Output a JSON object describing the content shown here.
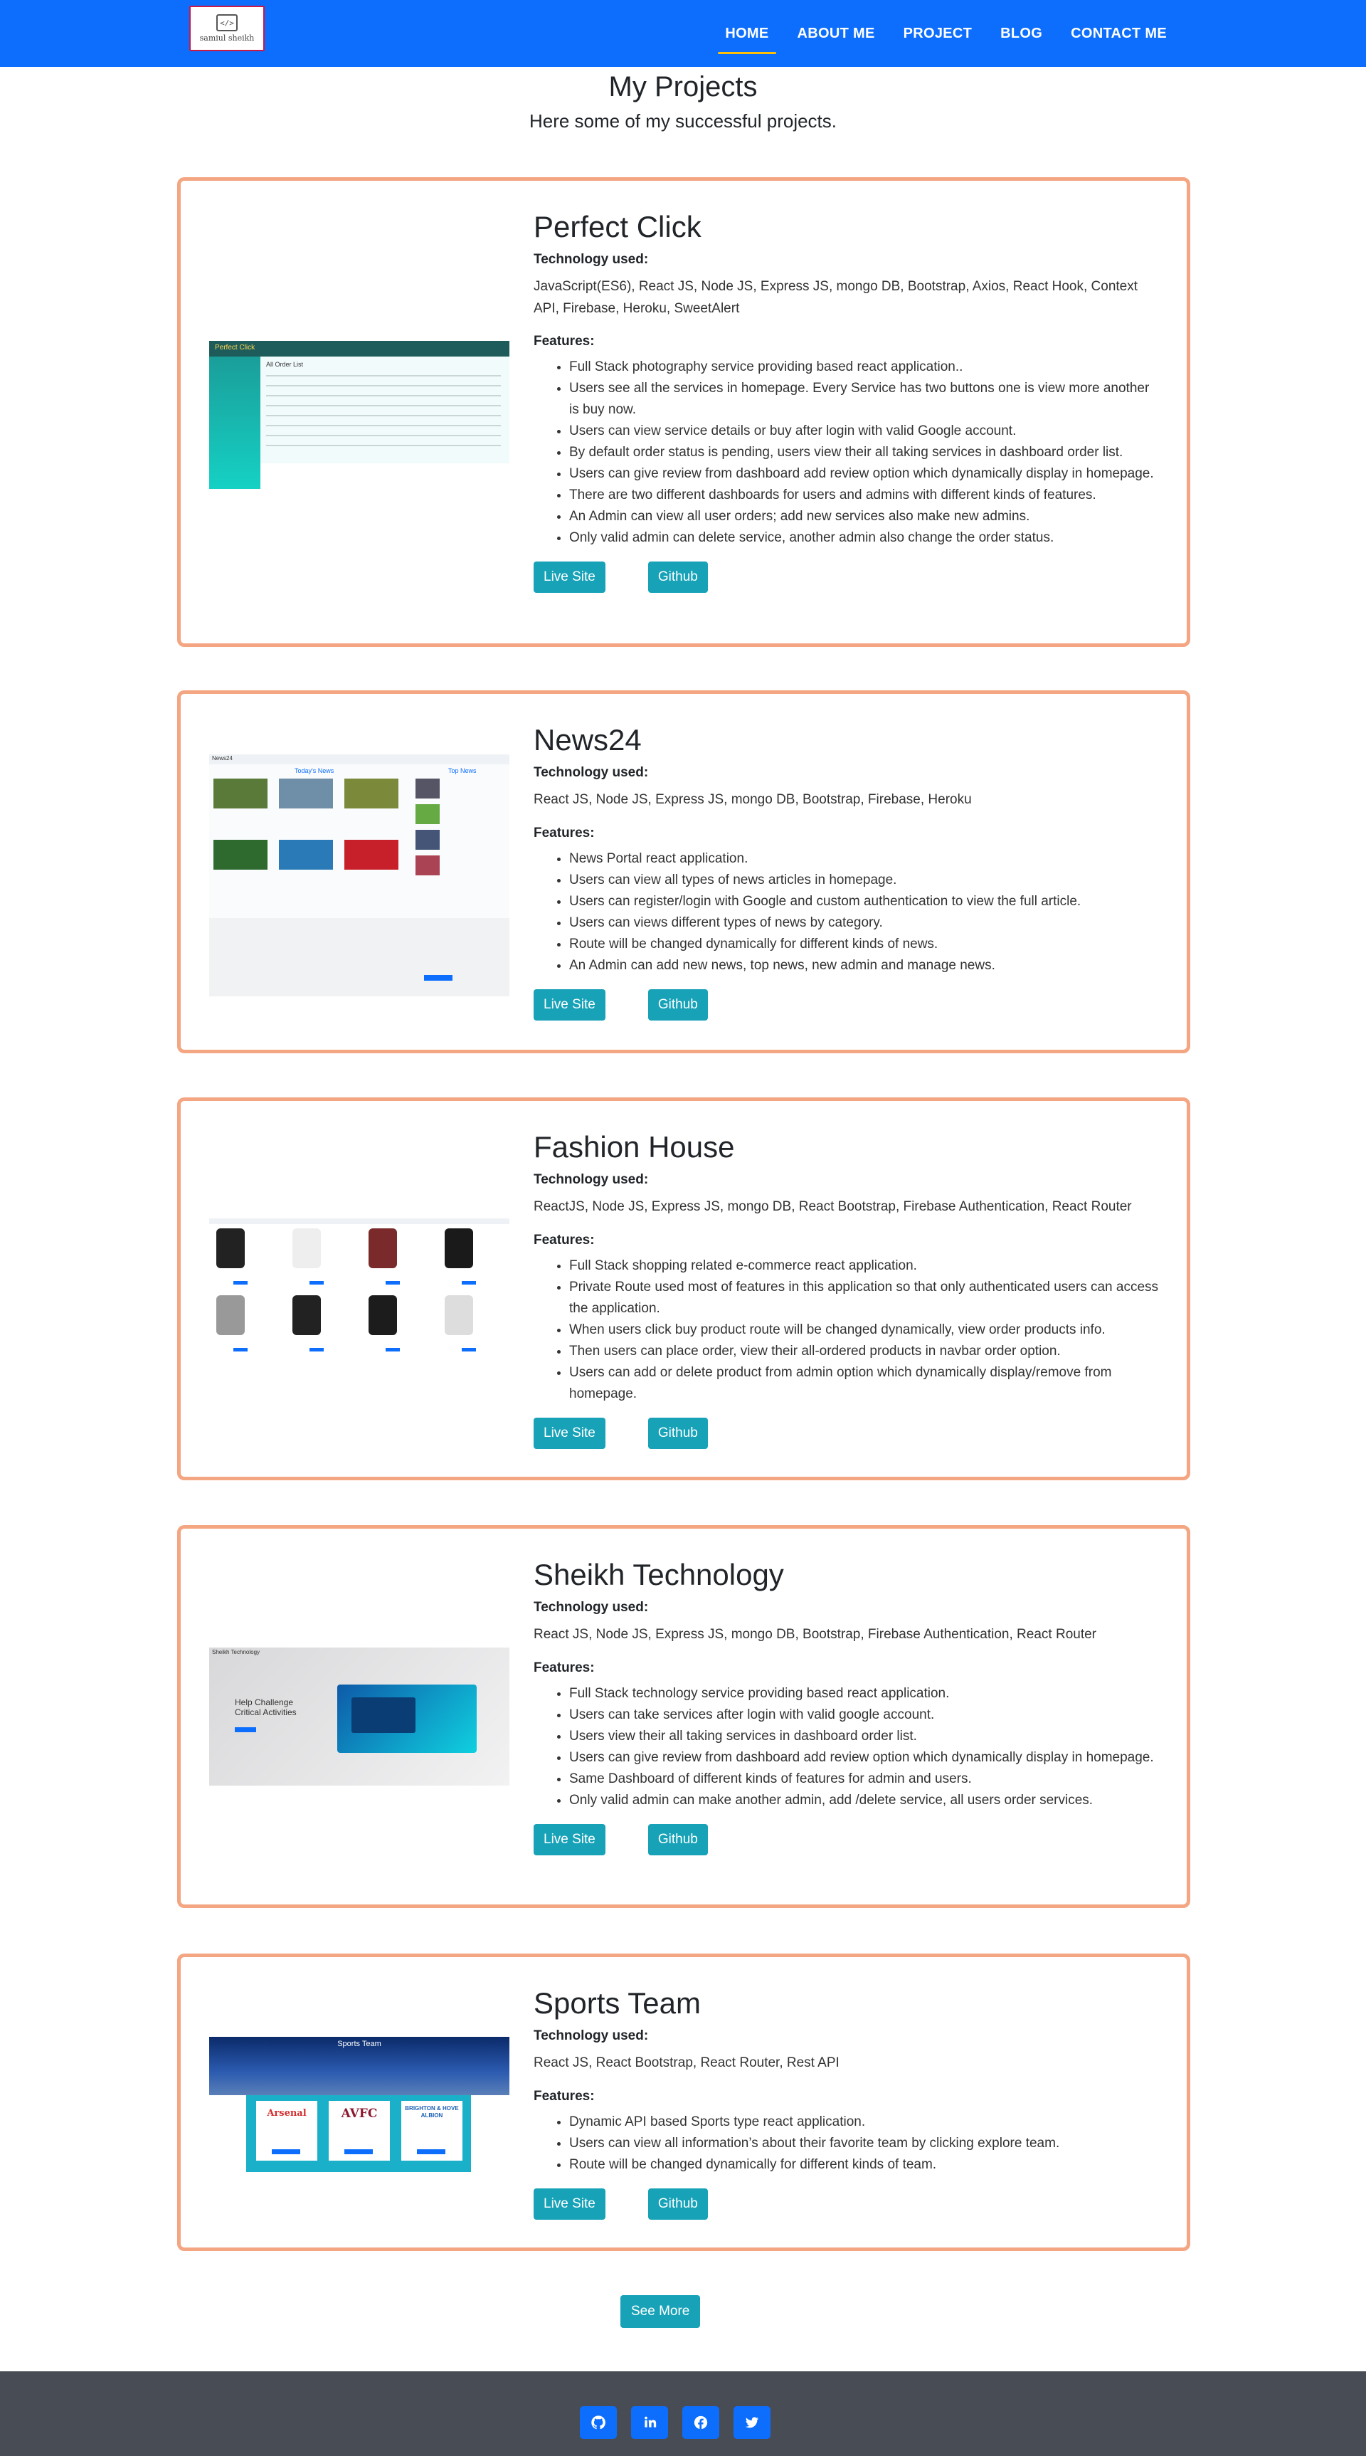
{
  "nav": {
    "logo_text": "samiul sheikh",
    "logo_mark": "</>",
    "links": [
      "HOME",
      "ABOUT ME",
      "PROJECT",
      "BLOG",
      "CONTACT ME"
    ]
  },
  "header": {
    "title": "My Projects",
    "subtitle": "Here some of my successful projects."
  },
  "labels": {
    "tech": "Technology used:",
    "features": "Features:",
    "live": "Live Site",
    "github": "Github",
    "see_more": "See More"
  },
  "projects": [
    {
      "title": "Perfect Click",
      "tech": "JavaScript(ES6), React JS, Node JS, Express JS, mongo DB, Bootstrap, Axios, React Hook, Context API, Firebase, Heroku, SweetAlert",
      "features": [
        "Full Stack photography service providing based react application..",
        "Users see all the services in homepage. Every Service has two buttons one is view more another is buy now.",
        "Users can view service details or buy after login with valid Google account.",
        "By default order status is pending, users view their all taking services in dashboard order list.",
        "Users can give review from dashboard add review option which dynamically display in homepage.",
        "There are two different dashboards for users and admins with different kinds of features.",
        "An Admin can view all user orders; add new services also make new admins.",
        "Only valid admin can delete service, another admin also change the order status."
      ]
    },
    {
      "title": "News24",
      "tech": "React JS, Node JS, Express JS, mongo DB, Bootstrap, Firebase, Heroku",
      "features": [
        "News Portal react application.",
        "Users can view all types of news articles in homepage.",
        "Users can register/login with Google and custom authentication to view the full article.",
        "Users can views different types of news by category.",
        "Route will be changed dynamically for different kinds of news.",
        "An Admin can add new news, top news, new admin and manage news."
      ]
    },
    {
      "title": "Fashion House",
      "tech": "ReactJS, Node JS, Express JS, mongo DB, React Bootstrap, Firebase Authentication, React Router",
      "features": [
        "Full Stack shopping related e-commerce react application.",
        "Private Route used most of features in this application so that only authenticated users can access the application.",
        "When users click buy product route will be changed dynamically, view order products info.",
        "Then users can place order, view their all-ordered products in navbar order option.",
        "Users can add or delete product from admin option which dynamically display/remove from homepage."
      ]
    },
    {
      "title": "Sheikh Technology",
      "tech": "React JS, Node JS, Express JS, mongo DB, Bootstrap, Firebase Authentication, React Router",
      "features": [
        "Full Stack technology service providing based react application.",
        "Users can take services after login with valid google account.",
        "Users view their all taking services in dashboard order list.",
        "Users can give review from dashboard add review option which dynamically display in homepage.",
        "Same Dashboard of different kinds of features for admin and users.",
        "Only valid admin can make another admin, add /delete service, all users order services."
      ]
    },
    {
      "title": "Sports Team",
      "tech": "React JS, React Bootstrap, React Router, Rest API",
      "features": [
        "Dynamic API based Sports type react application.",
        "Users can view all information’s about their favorite team by clicking explore team.",
        "Route will be changed dynamically for different kinds of team."
      ]
    }
  ],
  "screens": {
    "perfect_click": {
      "brand": "Perfect Click",
      "heading": "All Order List"
    },
    "news24": {
      "brand": "News24",
      "heading": "Today's News",
      "side": "Top News"
    },
    "sheikh_tech": {
      "brand": "Sheikh Technology",
      "headline": "Help Challenge Critical Activities"
    },
    "sports": {
      "title": "Sports Team",
      "teams": [
        "Arsenal",
        "AVFC",
        "BRIGHTON & HOVE ALBION"
      ]
    }
  },
  "colors": {
    "nav_bg": "#0d6efd",
    "card_border": "#f4a582",
    "button": "#17a2b8",
    "footer": "#474c55",
    "active_underline": "#ffc107"
  },
  "footer": {
    "social_icons": [
      "github-icon",
      "linkedin-icon",
      "facebook-icon",
      "twitter-icon"
    ]
  }
}
